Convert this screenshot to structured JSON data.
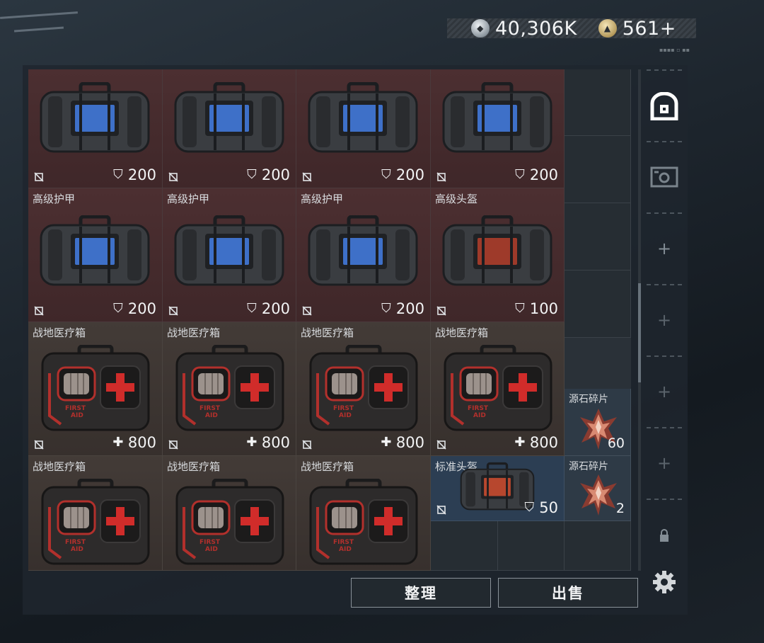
{
  "header": {
    "currency_silver": "40,306K",
    "currency_gold": "561+",
    "silver_icon": "silver-coin-icon",
    "gold_icon": "gold-coin-icon"
  },
  "inventory": {
    "row1": [
      {
        "name": "",
        "value": "200",
        "type": "armor"
      },
      {
        "name": "",
        "value": "200",
        "type": "armor"
      },
      {
        "name": "",
        "value": "200",
        "type": "armor"
      },
      {
        "name": "",
        "value": "200",
        "type": "armor"
      }
    ],
    "row2": [
      {
        "name": "高级护甲",
        "value": "200",
        "type": "armor"
      },
      {
        "name": "高级护甲",
        "value": "200",
        "type": "armor"
      },
      {
        "name": "高级护甲",
        "value": "200",
        "type": "armor"
      },
      {
        "name": "高级头盔",
        "value": "100",
        "type": "helmet"
      }
    ],
    "row3": [
      {
        "name": "战地医疗箱",
        "value": "800",
        "type": "med"
      },
      {
        "name": "战地医疗箱",
        "value": "800",
        "type": "med"
      },
      {
        "name": "战地医疗箱",
        "value": "800",
        "type": "med"
      },
      {
        "name": "战地医疗箱",
        "value": "800",
        "type": "med"
      }
    ],
    "shard1": {
      "name": "源石碎片",
      "count": "60"
    },
    "row4": [
      {
        "name": "战地医疗箱",
        "type": "med"
      },
      {
        "name": "战地医疗箱",
        "type": "med"
      },
      {
        "name": "战地医疗箱",
        "type": "med"
      }
    ],
    "helmet_std": {
      "name": "标准头盔",
      "value": "50"
    },
    "shard2": {
      "name": "源石碎片",
      "count": "2"
    },
    "med_text": "FIRST AID"
  },
  "sidebar": {
    "icons": [
      "backpack-icon",
      "vehicle-icon",
      "plus-icon",
      "plus-icon",
      "plus-icon",
      "plus-icon",
      "lock-icon"
    ],
    "plus_symbol": "+"
  },
  "actions": {
    "organize_label": "整理",
    "sell_label": "出售"
  },
  "colors": {
    "armor_bg": "#4c2f31",
    "med_bg": "#433b37",
    "helmet_std_bg": "#2c3e53",
    "shard_bg": "#2e3a46"
  }
}
